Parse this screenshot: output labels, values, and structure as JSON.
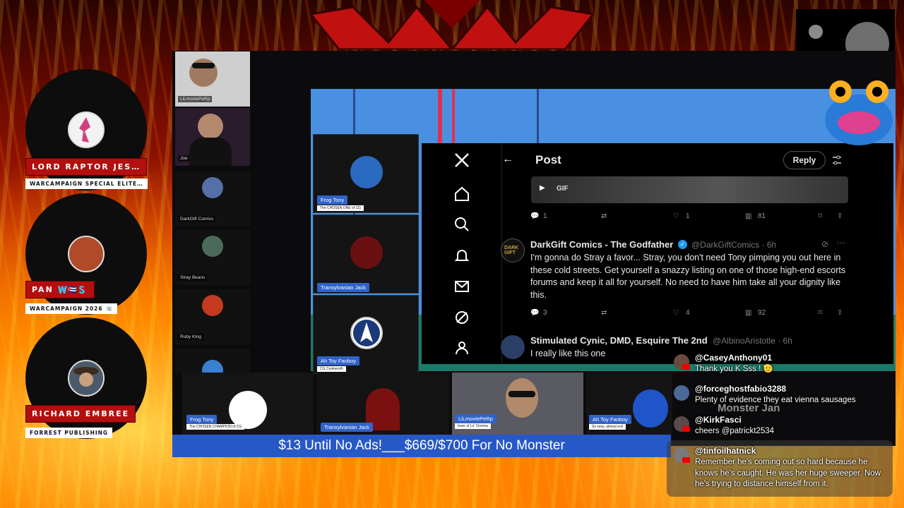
{
  "speakers": [
    {
      "name": "LORD RAPTOR JES…",
      "subtitle": "WARCAMPAIGN SPECIAL ELITE…",
      "color": "#e6e6e6"
    },
    {
      "name": "PAN 🇼🇨🇺🇸",
      "subtitle": "WARCAMPAIGN 2026 🇼🇨",
      "color": "#b04a2a"
    },
    {
      "name": "RICHARD EMBREE",
      "subtitle": "FORREST PUBLISHING",
      "color": "#4a5a6a"
    }
  ],
  "side_participants": [
    {
      "label": "LiLmoviePeRp"
    },
    {
      "label": "Joe"
    },
    {
      "label": "DarkGift Comics"
    },
    {
      "label": "Stray Beans"
    },
    {
      "label": "Ruby King"
    }
  ],
  "mid_tiles": [
    {
      "name": "Frog Tony",
      "sub": "The CHOSEN ONE of CG"
    },
    {
      "name": "Transylvanian Jack",
      "sub": ""
    },
    {
      "name": "Ah Toy Fanboy",
      "sub": "CG Cookworth"
    }
  ],
  "x_post": {
    "header": "Post",
    "back": "←",
    "reply_label": "Reply",
    "gif_label": "GIF",
    "first_actions": {
      "replies": "1",
      "likes": "1",
      "views": "81"
    },
    "tweet1": {
      "author": "DarkGift Comics - The Godfather",
      "handle": "@DarkGiftComics · 6h",
      "text": "I'm gonna do Stray a favor... Stray, you don't need Tony pimping you out here in these cold streets. Get yourself a snazzy listing on one of those high-end escorts forums and keep it all for yourself. No need to have him take all your dignity like this.",
      "replies": "3",
      "likes": "4",
      "views": "92"
    },
    "tweet2": {
      "author": "Stimulated Cynic, DMD, Esquire The 2nd",
      "handle": "@AlbinoAristotle · 6h",
      "text": "I really like this one"
    }
  },
  "bottom_tiles": [
    {
      "name": "Frog Tony",
      "sub": "The CHOSEN CHAMPION of CG"
    },
    {
      "name": "Transylvanian Jack",
      "sub": ""
    },
    {
      "name": "LiLmoviePeRp",
      "sub": "lover of Le' Cinema"
    },
    {
      "name": "Ah Toy Fanboy",
      "sub": "So sexy, almost evil"
    }
  ],
  "ticker": "$13 Until No Ads!___$669/$700 For No Monster",
  "overlay_text": "Monster Jan",
  "chat": [
    {
      "user": "@CaseyAnthony01",
      "text": "Thank you K Sss ! 🫡"
    },
    {
      "user": "@forceghostfabio3288",
      "text": "Plenty of evidence they eat vienna sausages"
    },
    {
      "user": "@KirkFasci",
      "text": "cheers @patrickt2534"
    },
    {
      "user": "@tinfoilhatnick",
      "text": "Remember he's coming out so hard because he knows he's caught. He was her huge sweeper. Now he's trying to distance himself from it."
    }
  ],
  "colors": {
    "ticker_bg": "#2758c8",
    "plate_red": "#b30f0f",
    "x_bg": "#000000",
    "verified": "#1d9bf0"
  }
}
